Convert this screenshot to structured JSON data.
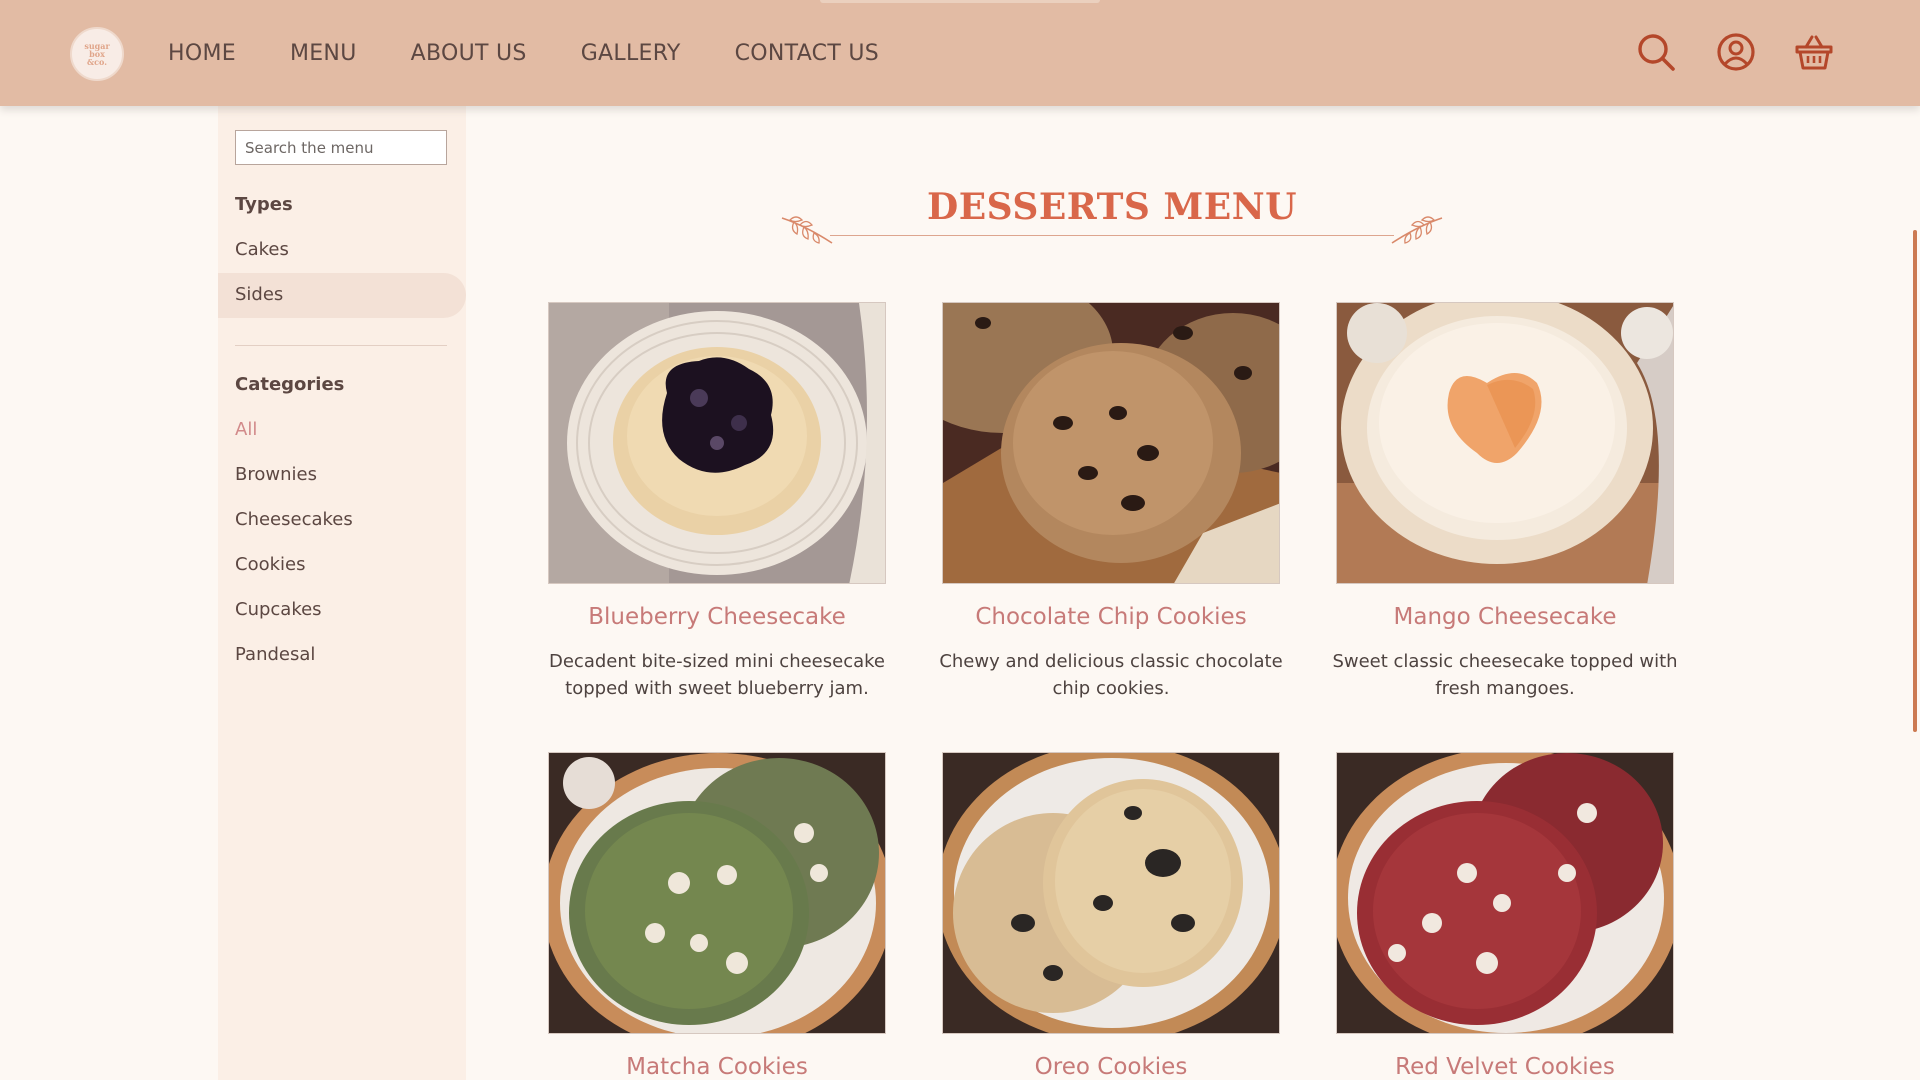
{
  "header": {
    "logo_text": "sugar\nbox\n&co.",
    "nav": [
      "HOME",
      "MENU",
      "ABOUT US",
      "GALLERY",
      "CONTACT US"
    ],
    "icons": [
      "search-icon",
      "user-account-icon",
      "shopping-basket-icon"
    ]
  },
  "sidebar": {
    "search_placeholder": "Search the menu",
    "types_heading": "Types",
    "types": [
      "Cakes",
      "Sides"
    ],
    "active_type": "Sides",
    "categories_heading": "Categories",
    "categories": [
      "All",
      "Brownies",
      "Cheesecakes",
      "Cookies",
      "Cupcakes",
      "Pandesal"
    ],
    "active_category": "All"
  },
  "main": {
    "title": "DESSERTS MENU",
    "products": [
      {
        "name": "Blueberry Cheesecake",
        "description": "Decadent bite-sized mini cheesecake topped with sweet blueberry jam."
      },
      {
        "name": "Chocolate Chip Cookies",
        "description": "Chewy and delicious classic chocolate chip cookies."
      },
      {
        "name": "Mango Cheesecake",
        "description": "Sweet classic cheesecake topped with fresh mangoes."
      },
      {
        "name": "Matcha Cookies",
        "description": ""
      },
      {
        "name": "Oreo Cookies",
        "description": ""
      },
      {
        "name": "Red Velvet Cookies",
        "description": ""
      }
    ]
  },
  "colors": {
    "header_bg": "#e2bba4",
    "page_bg": "#fdf8f3",
    "sidebar_bg": "#fbefe6",
    "title": "#d9674a",
    "product_name": "#c77a78",
    "icon_stroke": "#b4472a"
  }
}
